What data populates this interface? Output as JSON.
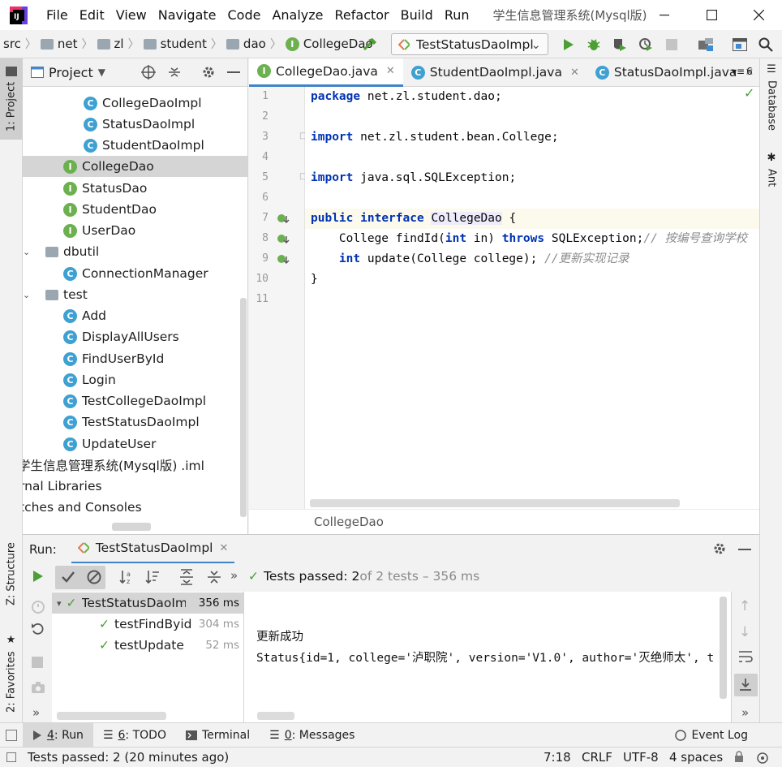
{
  "menubar": {
    "items": [
      {
        "label": "File"
      },
      {
        "label": "Edit"
      },
      {
        "label": "View"
      },
      {
        "label": "Navigate"
      },
      {
        "label": "Code"
      },
      {
        "label": "Analyze"
      },
      {
        "label": "Refactor"
      },
      {
        "label": "Build"
      },
      {
        "label": "Run"
      }
    ],
    "window_title": "学生信息管理系统(Mysql版)"
  },
  "navbar": {
    "crumbs": [
      "src",
      "net",
      "zl",
      "student",
      "dao",
      "CollegeDao"
    ],
    "run_config": "TestStatusDaoImpl"
  },
  "stripes": {
    "left_top": "1: Project",
    "left_structure": "Z: Structure",
    "left_favorites": "2: Favorites",
    "right_database": "Database",
    "right_ant": "Ant"
  },
  "project": {
    "title": "Project",
    "tree": [
      {
        "label": "CollegeDaoImpl",
        "kind": "class"
      },
      {
        "label": "StatusDaoImpl",
        "kind": "class"
      },
      {
        "label": "StudentDaoImpl",
        "kind": "class"
      },
      {
        "label": "CollegeDao",
        "kind": "interface"
      },
      {
        "label": "StatusDao",
        "kind": "interface"
      },
      {
        "label": "StudentDao",
        "kind": "interface"
      },
      {
        "label": "UserDao",
        "kind": "interface"
      },
      {
        "label": "dbutil",
        "kind": "folder"
      },
      {
        "label": "ConnectionManager",
        "kind": "class"
      },
      {
        "label": "test",
        "kind": "folder"
      },
      {
        "label": "Add",
        "kind": "runclass"
      },
      {
        "label": "DisplayAllUsers",
        "kind": "runclass"
      },
      {
        "label": "FindUserById",
        "kind": "runclass"
      },
      {
        "label": "Login",
        "kind": "runclass"
      },
      {
        "label": "TestCollegeDaoImpl",
        "kind": "runclass"
      },
      {
        "label": "TestStatusDaoImpl",
        "kind": "runclass"
      },
      {
        "label": "UpdateUser",
        "kind": "runclass"
      },
      {
        "label": "学生信息管理系统(Mysql版)  .iml",
        "kind": "text"
      },
      {
        "label": "rnal Libraries",
        "kind": "text"
      },
      {
        "label": "tches and Consoles",
        "kind": "text"
      }
    ]
  },
  "editor": {
    "tabs": [
      {
        "label": "CollegeDao.java",
        "kind": "interface"
      },
      {
        "label": "StudentDaoImpl.java",
        "kind": "class"
      },
      {
        "label": "StatusDaoImpl.java",
        "kind": "class"
      }
    ],
    "tab_overflow": "6",
    "line_numbers": [
      "1",
      "2",
      "3",
      "4",
      "5",
      "6",
      "7",
      "8",
      "9",
      "10",
      "11"
    ],
    "lines": {
      "l1_kw": "package",
      "l1_rest": " net.zl.student.dao;",
      "l3_kw": "import",
      "l3_rest": " net.zl.student.bean.College;",
      "l5_kw": "import",
      "l5_rest": " java.sql.SQLException;",
      "l7_kw1": "public",
      "l7_kw2": "interface",
      "l7_name": "CollegeDao",
      "l7_rest": " {",
      "l8_a": "    College findId(",
      "l8_kw1": "int",
      "l8_b": " in) ",
      "l8_kw2": "throws",
      "l8_c": " SQLException;",
      "l8_cm": "// 按编号查询学校",
      "l9_kw": "    int",
      "l9_b": " update(College college); ",
      "l9_cm": "//更新实现记录",
      "l10": "}"
    },
    "bottom_breadcrumb": "CollegeDao"
  },
  "run": {
    "label": "Run:",
    "tab": "TestStatusDaoImpl",
    "summary_bold": "Tests passed: 2",
    "summary_rest": " of 2 tests – 356 ms",
    "tests": [
      {
        "name": "TestStatusDaoImpl",
        "duration": "356 ms"
      },
      {
        "name": "testFindByid",
        "duration": "304 ms"
      },
      {
        "name": "testUpdate",
        "duration": "52 ms"
      }
    ],
    "console": [
      "更新成功",
      "Status{id=1, college='泸职院', version='V1.0', author='灭绝师太', t"
    ]
  },
  "bottom_tools": [
    {
      "num": "4",
      "label": ": Run"
    },
    {
      "num": "6",
      "label": ": TODO"
    },
    {
      "num": "",
      "label": "Terminal"
    },
    {
      "num": "0",
      "label": ": Messages"
    }
  ],
  "event_log": "Event Log",
  "status": {
    "message": "Tests passed: 2 (20 minutes ago)",
    "position": "7:18",
    "line_sep": "CRLF",
    "encoding": "UTF-8",
    "indent": "4 spaces"
  },
  "colors": {
    "accent": "#4083c9",
    "pass_green": "#4b9f34",
    "keyword": "#0033b3",
    "comment": "#8c8c8c"
  }
}
